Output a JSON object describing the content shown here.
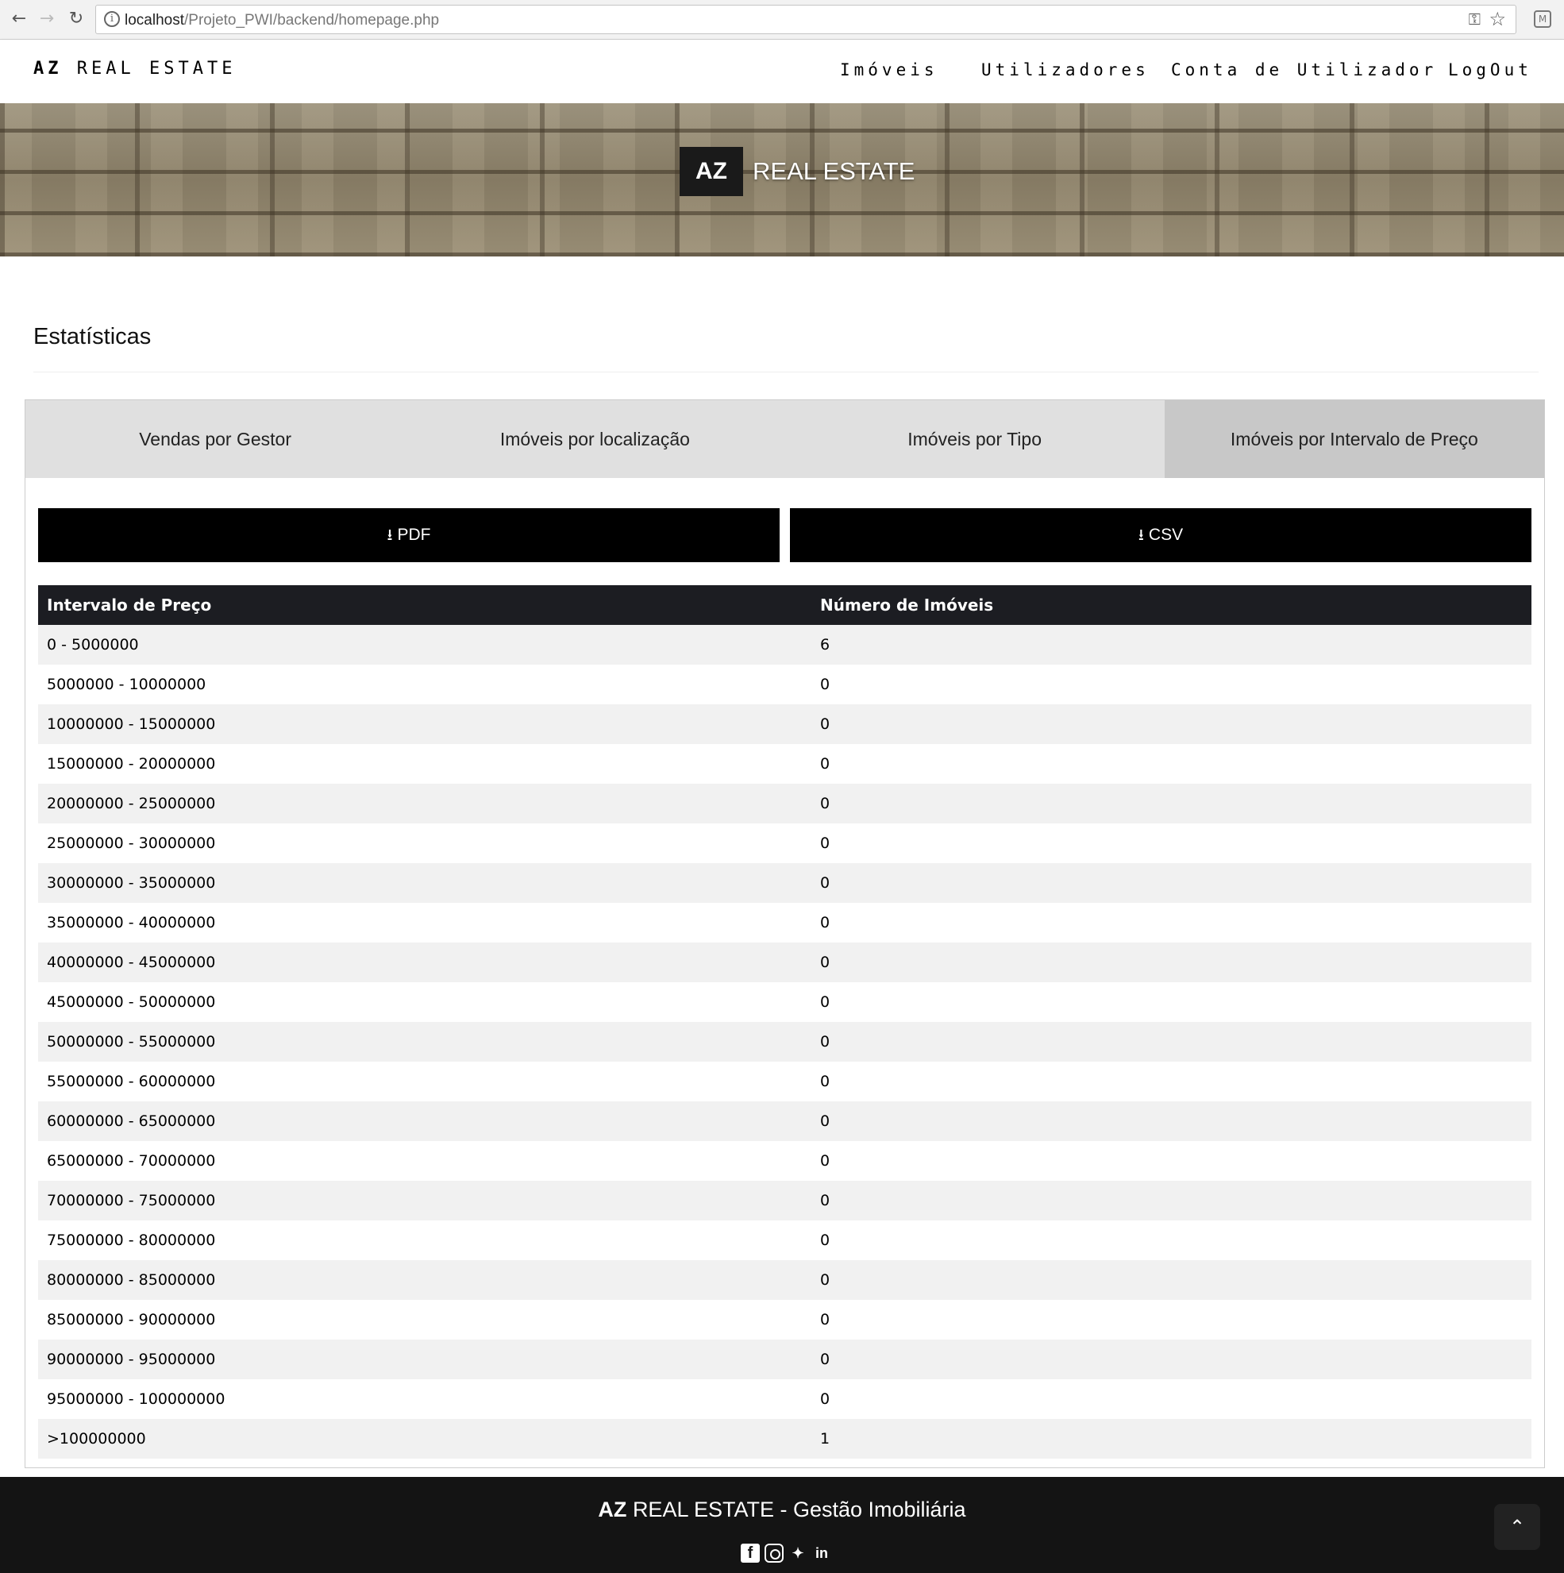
{
  "browser": {
    "url_host": "localhost",
    "url_path": "/Projeto_PWI/backend/homepage.php"
  },
  "nav": {
    "brand_bold": "AZ",
    "brand_rest": "REAL ESTATE",
    "items": [
      "Imóveis",
      "Utilizadores",
      "Conta de Utilizador",
      "LogOut"
    ]
  },
  "hero": {
    "logo_bold": "AZ",
    "logo_rest": "REAL ESTATE"
  },
  "page": {
    "title": "Estatísticas"
  },
  "tabs": [
    {
      "label": "Vendas por Gestor",
      "active": false
    },
    {
      "label": "Imóveis por localização",
      "active": false
    },
    {
      "label": "Imóveis por Tipo",
      "active": false
    },
    {
      "label": "Imóveis por Intervalo de Preço",
      "active": true
    }
  ],
  "export": {
    "pdf_label": "PDF",
    "csv_label": "CSV"
  },
  "table": {
    "headers": [
      "Intervalo de Preço",
      "Número de Imóveis"
    ],
    "rows": [
      [
        "0 - 5000000",
        "6"
      ],
      [
        "5000000 - 10000000",
        "0"
      ],
      [
        "10000000 - 15000000",
        "0"
      ],
      [
        "15000000 - 20000000",
        "0"
      ],
      [
        "20000000 - 25000000",
        "0"
      ],
      [
        "25000000 - 30000000",
        "0"
      ],
      [
        "30000000 - 35000000",
        "0"
      ],
      [
        "35000000 - 40000000",
        "0"
      ],
      [
        "40000000 - 45000000",
        "0"
      ],
      [
        "45000000 - 50000000",
        "0"
      ],
      [
        "50000000 - 55000000",
        "0"
      ],
      [
        "55000000 - 60000000",
        "0"
      ],
      [
        "60000000 - 65000000",
        "0"
      ],
      [
        "65000000 - 70000000",
        "0"
      ],
      [
        "70000000 - 75000000",
        "0"
      ],
      [
        "75000000 - 80000000",
        "0"
      ],
      [
        "80000000 - 85000000",
        "0"
      ],
      [
        "85000000 - 90000000",
        "0"
      ],
      [
        "90000000 - 95000000",
        "0"
      ],
      [
        "95000000 - 100000000",
        "0"
      ],
      [
        ">100000000",
        "1"
      ]
    ]
  },
  "footer": {
    "title_bold": "AZ",
    "title_rest": "REAL ESTATE - Gestão Imobiliária",
    "socials": [
      "facebook-icon",
      "instagram-icon",
      "twitter-icon",
      "linkedin-icon"
    ]
  }
}
